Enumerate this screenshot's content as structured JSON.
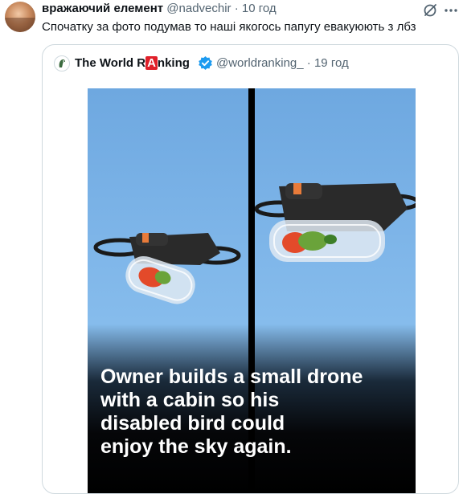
{
  "tweet": {
    "author_name": "вражаючий елемент",
    "handle": "@nadvechir",
    "separator": "·",
    "time": "10 год",
    "text": "Спочатку за фото подумав то наші якогось папугу евакуюють з лбз",
    "avatar_icon": "profile-avatar",
    "tools": [
      {
        "icon": "grok-slash-icon"
      },
      {
        "icon": "more-dots-icon"
      }
    ]
  },
  "quote": {
    "author_name_part1": "The World R",
    "author_name_highlight": "A",
    "author_name_part2": "nking",
    "handle": "@worldranking_",
    "separator": "·",
    "time": "19 год",
    "logo_icon": "parrot-logo-icon",
    "verified_icon": "verified-badge-icon",
    "verified_color": "#1d9bf0",
    "highlight_color": "#e0202a",
    "media": {
      "caption_lines": [
        "Owner builds a small drone",
        "with a cabin so his",
        "disabled bird could",
        "enjoy the sky again."
      ]
    }
  }
}
